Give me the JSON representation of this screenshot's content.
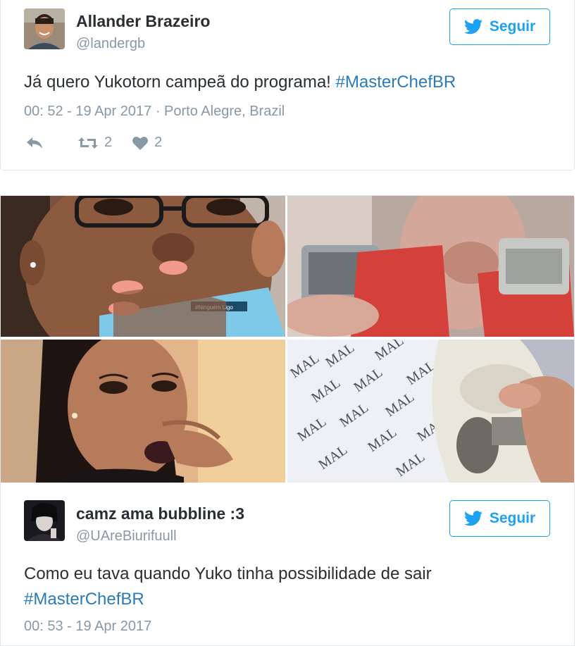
{
  "tweet1": {
    "author_name": "Allander Brazeiro",
    "author_handle": "@landergb",
    "follow_label": "Seguir",
    "text_plain": "Já quero Yukotorn campeã do programa! ",
    "text_hashtag": "#MasterChefBR",
    "timestamp": "00: 52 - 19 Apr 2017",
    "location": "· Porto Alegre, Brazil",
    "retweet_count": "2",
    "like_count": "2"
  },
  "tweet2": {
    "author_name": "camz ama bubbline :3",
    "author_handle": "@UAreBiurifuull",
    "follow_label": "Seguir",
    "text_plain": "Como eu tava quando Yuko tinha possibilidade de sair",
    "text_hashtag": "#MasterChefBR",
    "timestamp": "00: 53 - 19 Apr 2017",
    "photo_labels": {
      "phone_case": "#Ninguém Ligo",
      "paper_word": "MAL"
    }
  },
  "colors": {
    "twitter_blue": "#1da1f2",
    "hashtag": "#2b7bb9",
    "muted": "#8899a6",
    "text": "#292f33"
  },
  "icons": [
    "twitter-bird-icon",
    "reply-icon",
    "retweet-icon",
    "heart-icon"
  ]
}
